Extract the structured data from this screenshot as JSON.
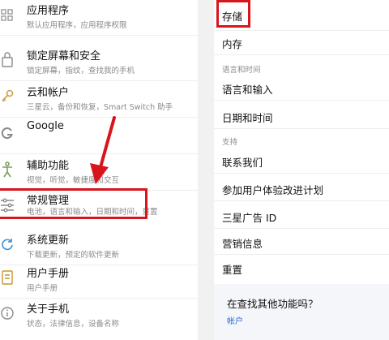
{
  "left_menu": [
    {
      "title": "应用程序",
      "subtitle": "默认应用程序，应用程序权限",
      "icon": "apps-grid-icon"
    },
    {
      "title": "锁定屏幕和安全",
      "subtitle": "锁定屏幕，指纹，查找我的手机",
      "icon": "lock-screen-icon"
    },
    {
      "title": "云和帐户",
      "subtitle": "三星云，备份和恢复，Smart Switch 助手",
      "icon": "key-icon"
    },
    {
      "title": "Google",
      "subtitle": "",
      "icon": "google-icon"
    },
    {
      "title": "辅助功能",
      "subtitle": "视觉，听觉，敏捷度和交互",
      "icon": "accessibility-icon"
    },
    {
      "title": "常规管理",
      "subtitle": "电池，语言和输入，日期和时间，重置",
      "icon": "sliders-icon"
    },
    {
      "title": "系统更新",
      "subtitle": "下载更新，预定的软件更新",
      "icon": "system-update-icon"
    },
    {
      "title": "用户手册",
      "subtitle": "用户手册",
      "icon": "manual-icon"
    },
    {
      "title": "关于手机",
      "subtitle": "状态，法律信息，设备名称",
      "icon": "info-icon"
    }
  ],
  "right_menu": {
    "storage": "存储",
    "memory": "内存",
    "section_language_time": "语言和时间",
    "language_input": "语言和输入",
    "date_time": "日期和时间",
    "section_support": "支持",
    "contact_us": "联系我们",
    "ux_program": "参加用户体验改进计划",
    "samsung_ad_id": "三星广告 ID",
    "marketing_info": "营销信息",
    "reset": "重置",
    "search_prompt": "在查找其他功能吗？",
    "search_link": "帐户"
  },
  "colors": {
    "highlight_red": "#d8141c",
    "link_blue": "#2f6dd6"
  }
}
